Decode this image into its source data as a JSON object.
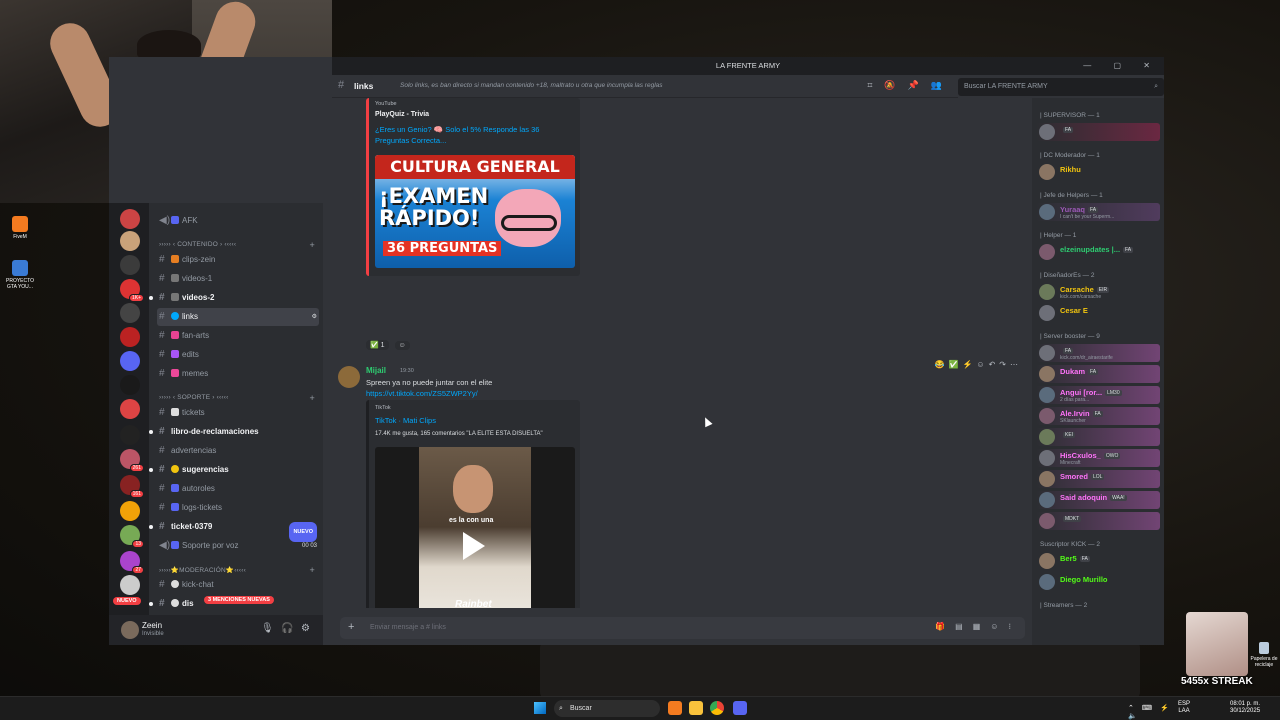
{
  "window": {
    "title": "LA FRENTE ARMY"
  },
  "desktop": {
    "icons": [
      "FiveM",
      "PROYECTO GTA YOU..."
    ]
  },
  "channel_header": {
    "name": "links",
    "topic": "Solo links, es ban directo si mandan contenido +18, maltrato u otra que incumpla las reglas",
    "search_placeholder": "Buscar LA FRENTE ARMY"
  },
  "channels": {
    "voice_afk": "AFK",
    "cat_contenido": "››››› ‹ CONTENIDO › ‹‹‹‹‹",
    "cat_soporte": "››››› ‹ SOPORTE › ‹‹‹‹‹",
    "cat_moderacion": "›››››⭐MODERACIÓN⭐‹‹‹‹‹",
    "items": {
      "clips_zein": "clips-zein",
      "videos_1": "videos-1",
      "videos_2": "videos-2",
      "links": "links",
      "fan_arts": "fan-arts",
      "edits": "edits",
      "memes": "memes",
      "tickets": "tickets",
      "libro": "libro-de-reclamaciones",
      "advertencias": "advertencias",
      "sugerencias": "sugerencias",
      "autoroles": "autoroles",
      "logs_tickets": "logs-tickets",
      "ticket_0379": "ticket-0379",
      "soporte_voz": "Soporte por voz",
      "kick_chat": "kick-chat",
      "dis": "dis"
    },
    "nuevo_badge": "NUEVO",
    "voice_counts": "00  03",
    "mentions": "3 MENCIONES NUEVAS"
  },
  "server_column": {
    "badges": [
      "1K+",
      "261",
      "161",
      "13",
      "27"
    ],
    "nuevo": "NUEVO"
  },
  "user": {
    "name": "Zeein",
    "status": "Invisible"
  },
  "messages": {
    "embed1": {
      "provider": "YouTube",
      "author": "PlayQuiz - Trivia",
      "title": "¿Eres un Genio? 🧠 Solo el 5% Responde las 36 Preguntas Correcta...",
      "thumb_band": "CULTURA GENERAL",
      "thumb_big": "¡EXAMEN RÁPIDO!",
      "thumb_sub": "36 PREGUNTAS",
      "reaction_count": "1"
    },
    "msg2": {
      "author": "Mijail",
      "time": "19:30",
      "text": "Spreen ya no puede juntar con el elite",
      "link": "https://vt.tiktok.com/ZS5ZWP2Yy/",
      "embed": {
        "provider": "TikTok",
        "title": "TikTok · Mati Clips",
        "desc": "17.4K me gusta, 165 comentarios \"LA ELITE ESTA DISUELTA\"",
        "caption": "es la con una",
        "watermark": "Rainbet"
      }
    }
  },
  "composer": {
    "placeholder": "Enviar mensaje a #",
    "channel": "links"
  },
  "members": {
    "groups": [
      {
        "header": "| SUPERVISOR — 1",
        "members": [
          {
            "name": "",
            "tag": "FA",
            "sub": "",
            "color": "#e91e63"
          }
        ]
      },
      {
        "header": "| DC Moderador — 1",
        "members": [
          {
            "name": "Rikhu",
            "tag": "",
            "sub": "",
            "color": "#f1c40f"
          }
        ]
      },
      {
        "header": "| Jefe de Helpers — 1",
        "members": [
          {
            "name": "Yuraaq",
            "tag": "FA",
            "sub": "I can't be your Superm...",
            "color": "#9b59b6"
          }
        ]
      },
      {
        "header": "| Helper — 1",
        "members": [
          {
            "name": "elzeinupdates |...",
            "tag": "FA",
            "sub": "",
            "color": "#2ecc71"
          }
        ]
      },
      {
        "header": "| DiseñadorEs — 2",
        "members": [
          {
            "name": "Carsache",
            "tag": "EIR",
            "sub": "kick.com/carsache",
            "color": "#f1c40f"
          },
          {
            "name": "Cesar E",
            "tag": "",
            "sub": "",
            "color": "#f1c40f"
          }
        ]
      },
      {
        "header": "| Server booster — 9",
        "members": [
          {
            "name": "",
            "tag": "FA",
            "sub": "kick.com/dr_airaestarife",
            "color": "#ff73fa"
          },
          {
            "name": "Dukam",
            "tag": "FA",
            "sub": "",
            "color": "#ff73fa"
          },
          {
            "name": "Angui [ror...",
            "tag": "LM30",
            "sub": "2 días para...",
            "color": "#ff73fa"
          },
          {
            "name": "Ale.Irvin",
            "tag": "FA",
            "sub": "SKlauncher",
            "color": "#ff73fa"
          },
          {
            "name": "",
            "tag": "KEI",
            "sub": "",
            "color": "#ff73fa"
          },
          {
            "name": "HisCxulos_",
            "tag": "OWO",
            "sub": "Minecraft",
            "color": "#ff73fa"
          },
          {
            "name": "Smored",
            "tag": "LOL",
            "sub": "",
            "color": "#ff73fa"
          },
          {
            "name": "Said adoquin",
            "tag": "WAA!",
            "sub": "",
            "color": "#ff73fa"
          },
          {
            "name": "",
            "tag": "MDKT",
            "sub": "",
            "color": "#ff73fa"
          }
        ]
      },
      {
        "header": "Suscriptor KICK — 2",
        "members": [
          {
            "name": "Ber5",
            "tag": "FA",
            "sub": "",
            "color": "#53fc18"
          },
          {
            "name": "Diego Murillo",
            "tag": "",
            "sub": "",
            "color": "#53fc18"
          }
        ]
      },
      {
        "header": "| Streamers — 2",
        "members": []
      }
    ]
  },
  "overlay": {
    "streak": "5455x STREAK",
    "recycle": "Papelera de reciclaje"
  },
  "taskbar": {
    "search": "Buscar",
    "lang1": "ESP",
    "lang2": "LAA",
    "time": "08:01 p. m.",
    "date": "30/12/2025"
  }
}
